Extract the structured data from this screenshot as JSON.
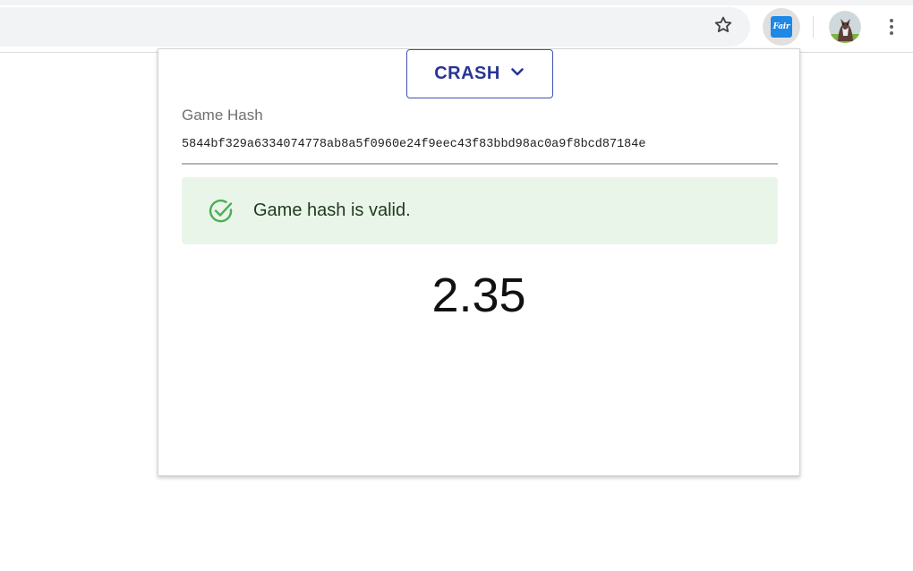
{
  "browser": {
    "bookmark_icon": "star-outline-icon",
    "extension": {
      "logo_text": "Fair",
      "color": "#1e88e5"
    },
    "menu_icon": "more-vert-icon"
  },
  "popup": {
    "game_selector": {
      "label": "CRASH",
      "icon": "chevron-down-icon",
      "accent_color": "#3f51b5"
    },
    "game_hash": {
      "label": "Game Hash",
      "value": "5844bf329a6334074778ab8a5f0960e24f9eec43f83bbd98ac0a9f8bcd87184e"
    },
    "validation": {
      "message": "Game hash is valid.",
      "icon": "check-circle-icon",
      "status_color": "#4caf50",
      "background": "#eaf5ea"
    },
    "result": {
      "multiplier": "2.35"
    }
  }
}
